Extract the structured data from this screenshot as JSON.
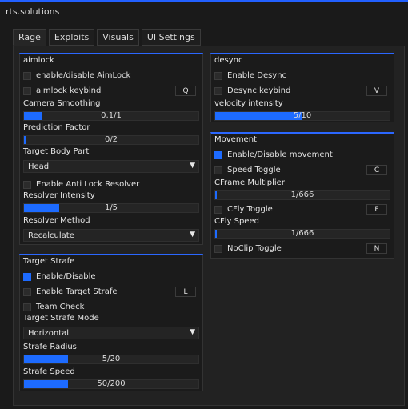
{
  "window": {
    "title": "rts.solutions"
  },
  "tabs": [
    {
      "label": "Rage",
      "active": true
    },
    {
      "label": "Exploits",
      "active": false
    },
    {
      "label": "Visuals",
      "active": false
    },
    {
      "label": "UI Settings",
      "active": false
    }
  ],
  "colors": {
    "accent": "#1d6bff",
    "panel_bg": "#1b1b1b"
  },
  "aimlock": {
    "title": "aimlock",
    "enable_label": "enable/disable AimLock",
    "keybind_label": "aimlock keybind",
    "keybind_key": "Q",
    "camera_smoothing_label": "Camera Smoothing",
    "camera_smoothing_value": "0.1/1",
    "camera_smoothing_fraction": 0.1,
    "prediction_label": "Prediction Factor",
    "prediction_value": "0/2",
    "prediction_fraction": 0,
    "body_part_label": "Target Body Part",
    "body_part_value": "Head",
    "anti_lock_label": "Enable Anti Lock Resolver",
    "resolver_intensity_label": "Resolver Intensity",
    "resolver_intensity_value": "1/5",
    "resolver_intensity_fraction": 0.2,
    "resolver_method_label": "Resolver Method",
    "resolver_method_value": "Recalculate"
  },
  "target_strafe": {
    "title": "Target Strafe",
    "enable_label": "Enable/Disable",
    "enable_checked": true,
    "enable_target_label": "Enable Target Strafe",
    "enable_target_key": "L",
    "team_check_label": "Team Check",
    "mode_label": "Target Strafe Mode",
    "mode_value": "Horizontal",
    "radius_label": "Strafe Radius",
    "radius_value": "5/20",
    "radius_fraction": 0.25,
    "speed_label": "Strafe Speed",
    "speed_value": "50/200",
    "speed_fraction": 0.25
  },
  "desync": {
    "title": "desync",
    "enable_label": "Enable Desync",
    "keybind_label": "Desync keybind",
    "keybind_key": "V",
    "velocity_label": "velocity intensity",
    "velocity_value": "5/10",
    "velocity_fraction": 0.5
  },
  "movement": {
    "title": "Movement",
    "enable_label": "Enable/Disable movement",
    "enable_checked": true,
    "speed_toggle_label": "Speed Toggle",
    "speed_toggle_key": "C",
    "cframe_label": "CFrame Multiplier",
    "cframe_value": "1/666",
    "cframe_fraction": 0.0015,
    "cfly_toggle_label": "CFly Toggle",
    "cfly_toggle_key": "F",
    "cfly_speed_label": "CFly Speed",
    "cfly_speed_value": "1/666",
    "cfly_speed_fraction": 0.0015,
    "noclip_label": "NoClip Toggle",
    "noclip_key": "N"
  }
}
